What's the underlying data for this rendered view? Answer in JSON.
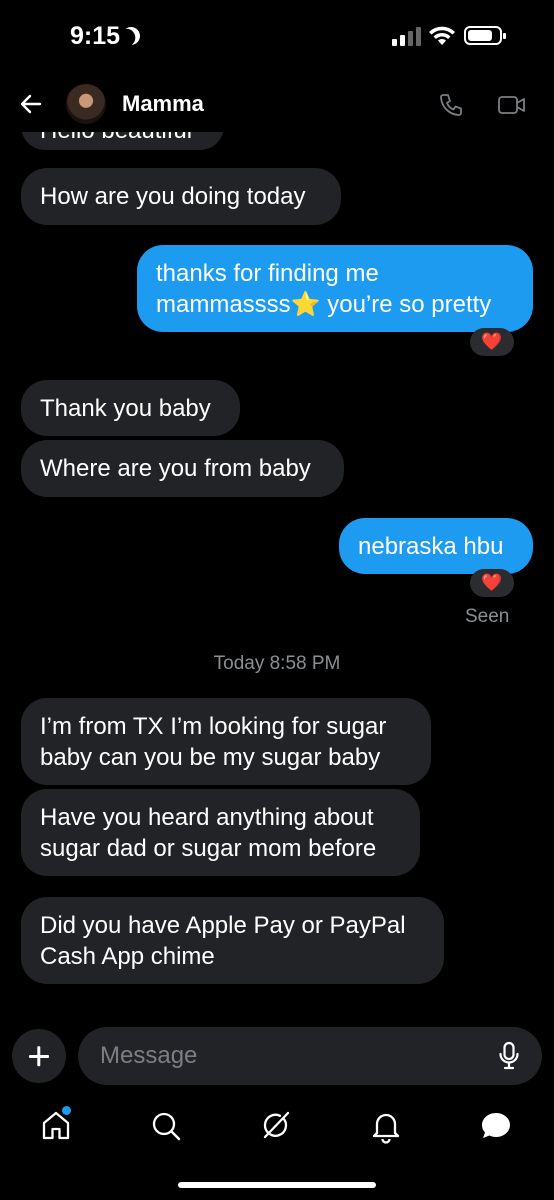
{
  "status_bar": {
    "time": "9:15",
    "battery_level": 0.8
  },
  "header": {
    "contact_name": "Mamma"
  },
  "messages": {
    "m0": "Hello beautiful",
    "m1": "How are you doing today",
    "m2_line1": "thanks for finding me",
    "m2_line2": "mammassss",
    "m2_emoji": "⭐",
    "m2_line2b": " you’re so pretty",
    "m3": "Thank you baby",
    "m4": "Where are you from baby",
    "m5": "nebraska hbu",
    "seen": "Seen",
    "timestamp": "Today 8:58 PM",
    "m6_line1": "I’m from TX I’m looking for sugar",
    "m6_line2": "baby can you be my sugar baby",
    "m7_line1": "Have you heard anything about",
    "m7_line2": "sugar dad or sugar mom before",
    "m8_line1": "Did you have Apple Pay or PayPal",
    "m8_line2": "Cash App chime"
  },
  "reactions": {
    "heart": "❤️"
  },
  "composer": {
    "placeholder": "Message"
  },
  "tabs": [
    "home-icon",
    "search-icon",
    "grok-icon",
    "bell-icon",
    "messages-icon"
  ],
  "colors": {
    "accent": "#1d9bf0",
    "incoming_bubble": "#222326",
    "background": "#000000"
  }
}
